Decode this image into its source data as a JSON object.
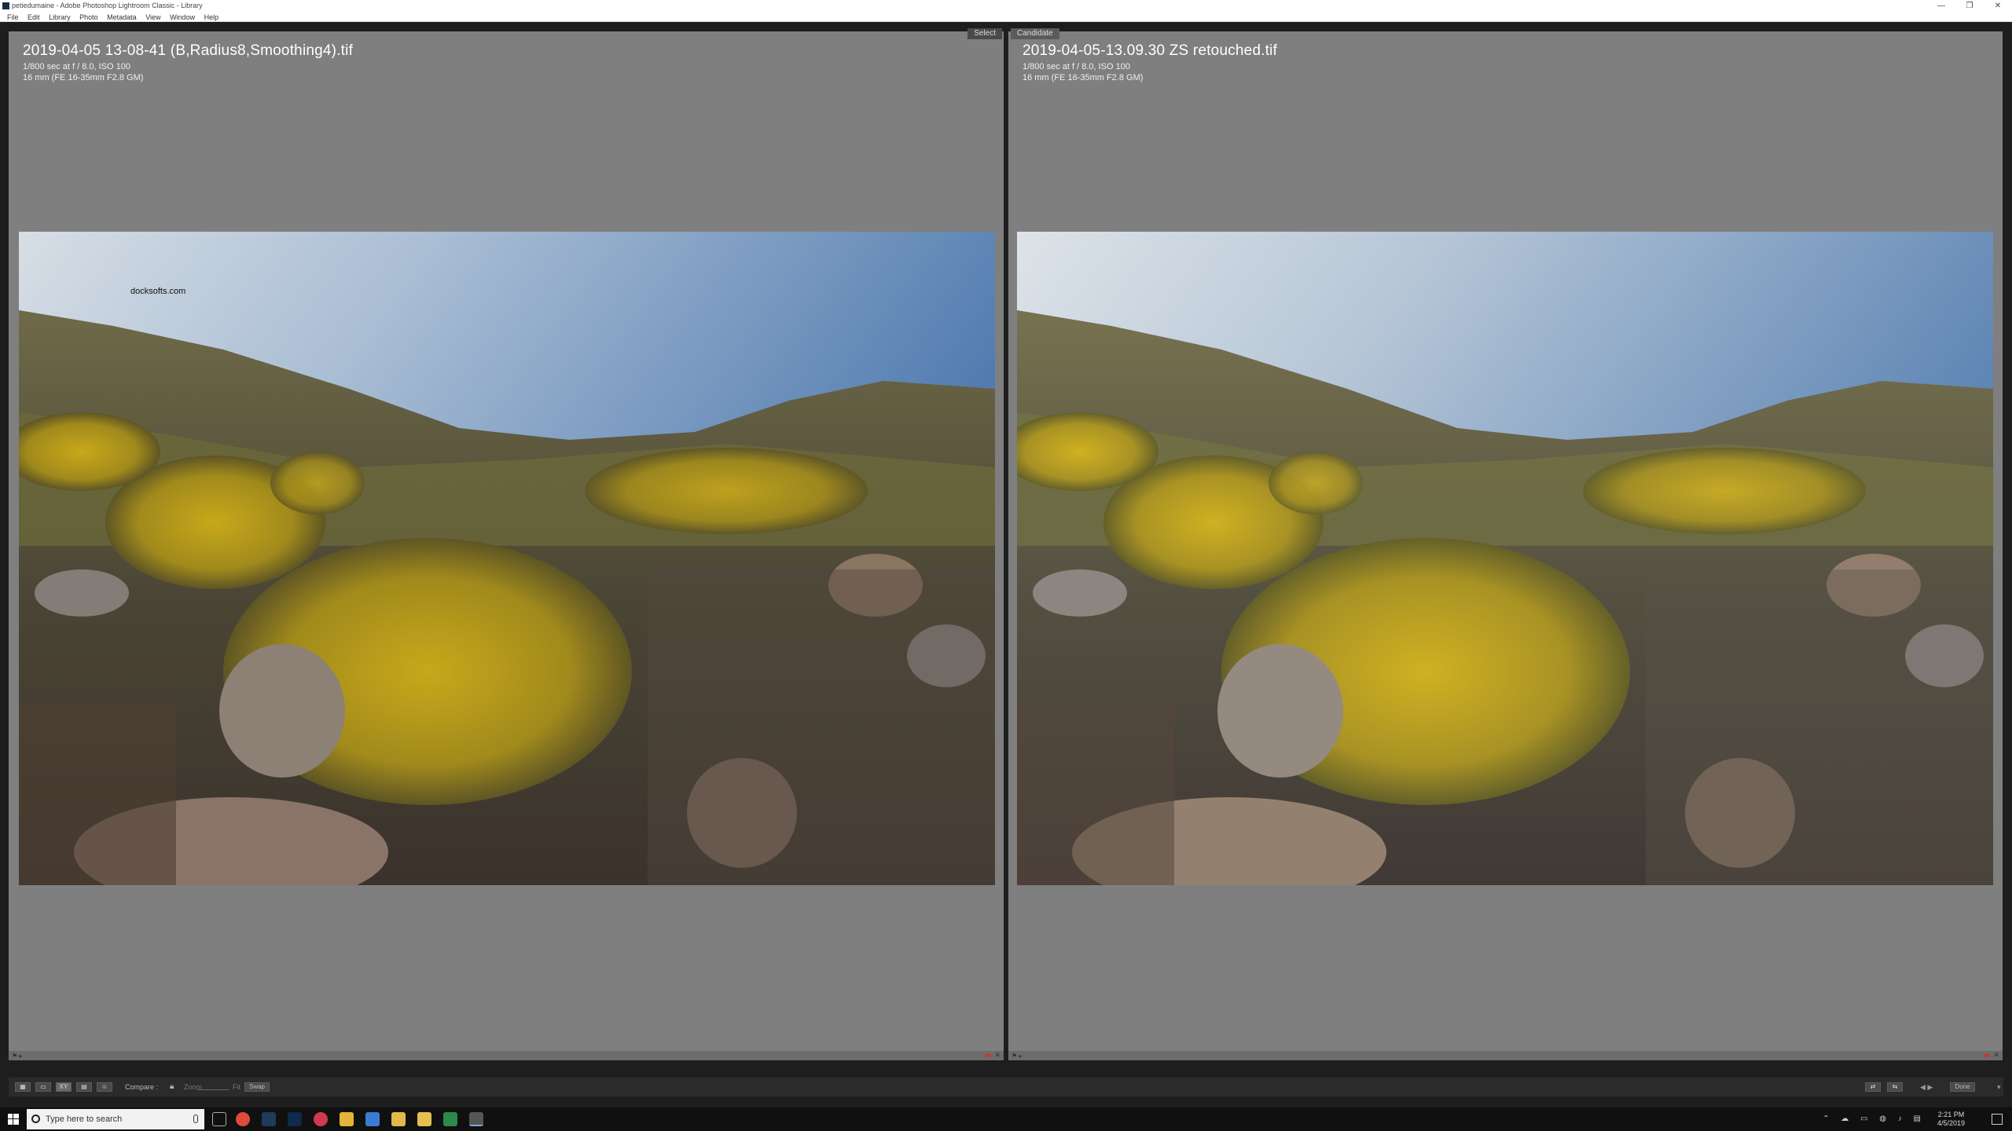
{
  "window": {
    "title": "petiedumaine - Adobe Photoshop Lightroom Classic - Library",
    "controls": [
      "—",
      "❐",
      "✕"
    ]
  },
  "menu": [
    "File",
    "Edit",
    "Library",
    "Photo",
    "Metadata",
    "View",
    "Window",
    "Help"
  ],
  "left_pane": {
    "tag": "Select",
    "filename": "2019-04-05 13-08-41 (B,Radius8,Smoothing4).tif",
    "exposure": "1/800 sec at f / 8.0, ISO 100",
    "lens": "16 mm (FE 16-35mm F2.8 GM)",
    "watermark": "docksofts.com"
  },
  "right_pane": {
    "tag": "Candidate",
    "filename": "2019-04-05-13.09.30 ZS retouched.tif",
    "exposure": "1/800 sec at f / 8.0, ISO 100",
    "lens": "16 mm (FE 16-35mm F2.8 GM)"
  },
  "toolbar": {
    "compare_label": "Compare :",
    "zoom_label": "Zoom",
    "fit_label": "Fit",
    "swap_label": "Swap",
    "view_buttons": [
      "grid",
      "loupe",
      "XY",
      "survey",
      "people"
    ],
    "done_label": "Done"
  },
  "taskbar": {
    "search_placeholder": "Type here to search",
    "time": "2:21 PM",
    "date": "4/5/2019"
  },
  "colors": {
    "pane_bg": "#7f7f7f",
    "app_bg": "#1e1e1e",
    "taskbar_bg": "#101010"
  }
}
